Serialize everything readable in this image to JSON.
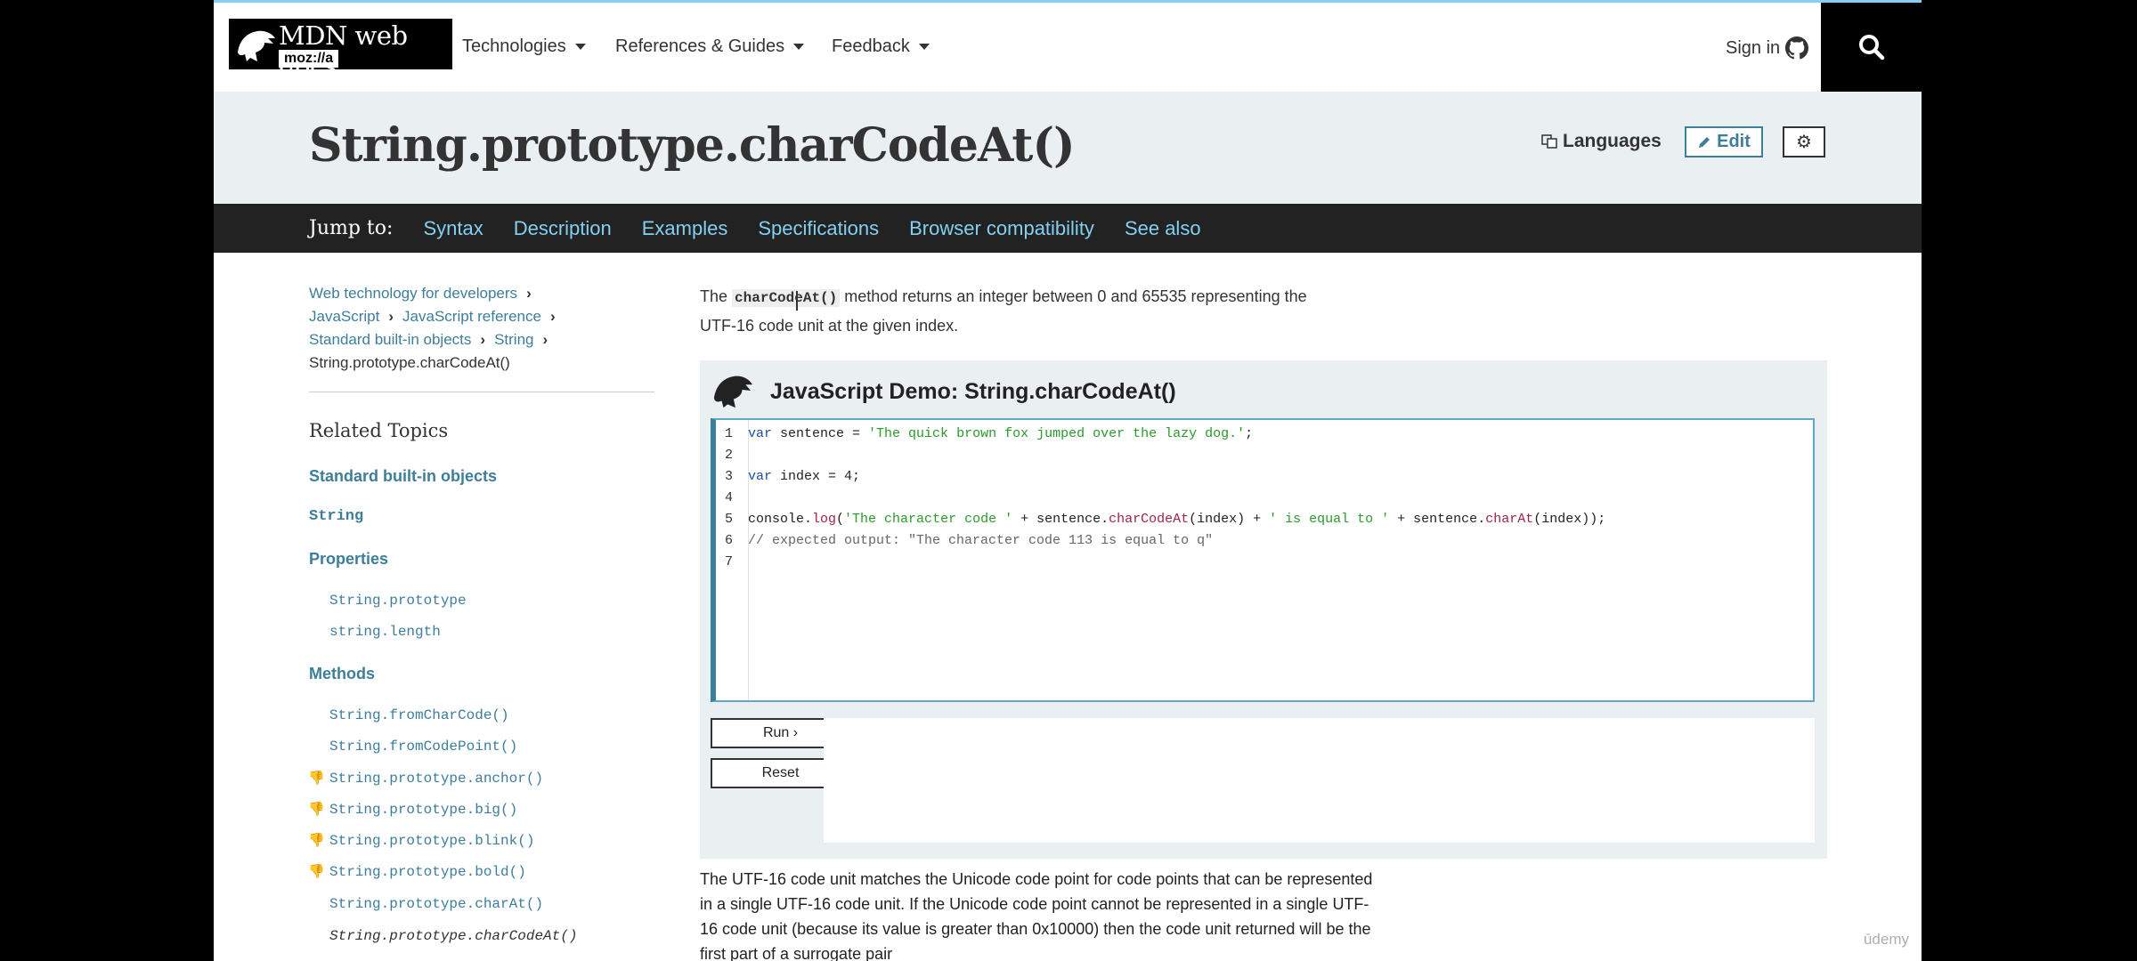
{
  "header": {
    "logo_text": "MDN web docs",
    "logo_moz": "moz://a",
    "nav": [
      "Technologies",
      "References & Guides",
      "Feedback"
    ],
    "signin": "Sign in",
    "icons": {
      "search": "search-icon",
      "github": "github-icon"
    }
  },
  "titleband": {
    "title": "String.prototype.charCodeAt()",
    "languages": "Languages",
    "edit": "Edit"
  },
  "jumpbar": {
    "label": "Jump to:",
    "links": [
      "Syntax",
      "Description",
      "Examples",
      "Specifications",
      "Browser compatibility",
      "See also"
    ]
  },
  "breadcrumbs": {
    "row1": [
      "Web technology for developers"
    ],
    "row2": [
      "JavaScript",
      "JavaScript reference"
    ],
    "row3": [
      "Standard built-in objects",
      "String"
    ],
    "current": "String.prototype.charCodeAt()"
  },
  "sidebar": {
    "related": "Related Topics",
    "standard": "Standard built-in objects",
    "string": "String",
    "properties_head": "Properties",
    "properties": [
      "String.prototype",
      "string.length"
    ],
    "methods_head": "Methods",
    "methods": [
      "String.fromCharCode()",
      "String.fromCodePoint()",
      "String.prototype.anchor()",
      "String.prototype.big()",
      "String.prototype.blink()",
      "String.prototype.bold()",
      "String.prototype.charAt()",
      "String.prototype.charCodeAt()"
    ]
  },
  "intro": {
    "pre": "The ",
    "code": "charCodeAt()",
    "post": " method returns an integer between 0 and 65535 representing the UTF-16 code unit at the given index."
  },
  "demo": {
    "title": "JavaScript Demo: String.charCodeAt()",
    "line_numbers": [
      "1",
      "2",
      "3",
      "4",
      "5",
      "6",
      "7"
    ],
    "lines": {
      "l1_kw": "var",
      "l1_a": " sentence = ",
      "l1_str": "'The quick brown fox jumped over the lazy dog.'",
      "l1_b": ";",
      "l3_kw": "var",
      "l3_a": " index = 4;",
      "l5_a": "console.",
      "l5_log": "log",
      "l5_b": "(",
      "l5_s1": "'The character code '",
      "l5_c": " + sentence.",
      "l5_f1": "charCodeAt",
      "l5_d": "(index) + ",
      "l5_s2": "' is equal to '",
      "l5_e": " + sentence.",
      "l5_f2": "charAt",
      "l5_g": "(index));",
      "l6": "// expected output: \"The character code 113 is equal to q\""
    },
    "run": "Run ›",
    "reset": "Reset"
  },
  "body_text": "The UTF-16 code unit matches the Unicode code point for code points that can be represented in a single UTF-16 code unit. If the Unicode code point cannot be represented in a single UTF-16 code unit (because its value is greater than 0x10000) then the code unit returned will be the first part of a surrogate pair",
  "watermark": "ūdemy"
}
